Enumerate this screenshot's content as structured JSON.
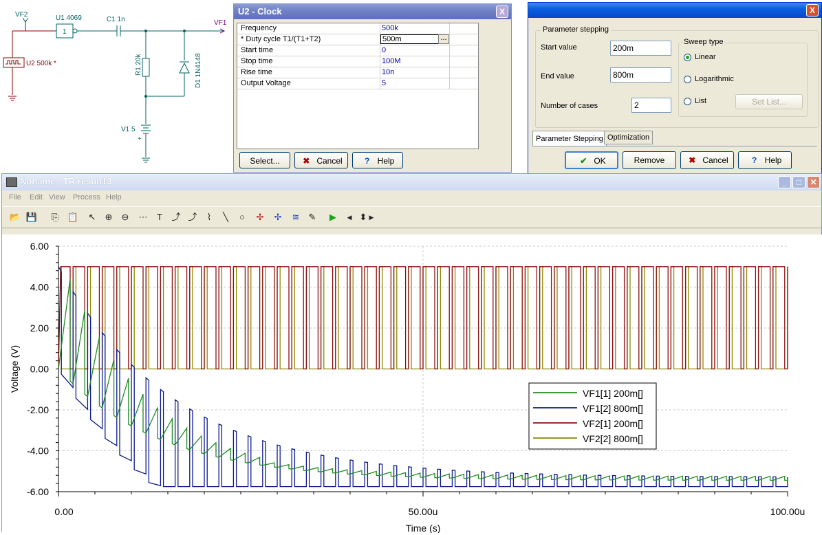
{
  "schematic": {
    "vf2_label": "VF2",
    "vf1_label": "VF1",
    "u1_label": "U1 4069",
    "gate_text": "1",
    "c1_label": "C1 1n",
    "u2_label": "U2 500k *",
    "r1_label": "R1 20k",
    "d1_label": "D1 1N4148",
    "v1_label": "V1 5",
    "plus_sign": "+"
  },
  "clock_dialog": {
    "title": "U2 - Clock",
    "close": "X",
    "rows": [
      {
        "key": "Frequency",
        "value": "500k"
      },
      {
        "key": "* Duty cycle T1/(T1+T2)",
        "value": "500m",
        "editing": true,
        "ellipsis": "..."
      },
      {
        "key": "Start time",
        "value": "0"
      },
      {
        "key": "Stop time",
        "value": "100M"
      },
      {
        "key": "Rise time",
        "value": "10n"
      },
      {
        "key": "Output Voltage",
        "value": "5"
      }
    ],
    "select_btn": "Select...",
    "cancel_btn": "Cancel",
    "help_btn": "Help"
  },
  "param_dialog": {
    "close": "X",
    "group_title": "Parameter stepping",
    "start_label": "Start value",
    "start_value": "200m",
    "end_label": "End value",
    "end_value": "800m",
    "cases_label": "Number of cases",
    "cases_value": "2",
    "sweep_title": "Sweep type",
    "sweep_options": [
      "Linear",
      "Logarithmic",
      "List"
    ],
    "sweep_selected": "Linear",
    "set_list_btn": "Set List...",
    "tabs": [
      "Parameter Stepping",
      "Optimization"
    ],
    "ok_btn": "OK",
    "remove_btn": "Remove",
    "cancel_btn": "Cancel",
    "help_btn": "Help"
  },
  "tr_window": {
    "title": "Noname - TR result13",
    "menu": [
      "File",
      "Edit",
      "View",
      "Process",
      "Help"
    ],
    "toolbar_icons": [
      "open-icon",
      "save-icon",
      "copy-icon",
      "paste-icon",
      "pointer-icon",
      "zoom-in-icon",
      "zoom-out-icon",
      "grid-icon",
      "text-icon",
      "curve-label-icon",
      "curve-label2-icon",
      "axis-label-icon",
      "line-icon",
      "circle-icon",
      "cursor-a-icon",
      "cursor-b-icon",
      "waveform-icon",
      "probe-icon",
      "run-icon",
      "scroll-left-icon",
      "scroll-updown-icon",
      "scroll-right-icon"
    ],
    "colors": {
      "vf1_200m": "#1f8a1f",
      "vf1_800m": "#0a1a8c",
      "vf2_200m": "#8c1010",
      "vf2_800m": "#8c8a00"
    }
  },
  "chart_data": {
    "type": "line",
    "xlabel": "Time (s)",
    "ylabel": "Voltage (V)",
    "xlim": [
      0,
      100
    ],
    "ylim": [
      -6,
      6
    ],
    "x_ticks": [
      "0.00",
      "50.00u",
      "100.00u"
    ],
    "y_ticks": [
      "6.00",
      "4.00",
      "2.00",
      "0.00",
      "-2.00",
      "-4.00",
      "-6.00"
    ],
    "grid": true,
    "legend_placement": "center-right",
    "period_us": 2,
    "series": [
      {
        "name": "VF1[1]  200m[]",
        "color": "#1f8a1f",
        "low_start": 0,
        "low_end": -5.4,
        "spike": 0.3
      },
      {
        "name": "VF1[2]  800m[]",
        "color": "#0a1a8c",
        "low_start": 5.0,
        "low_end": -5.6,
        "spike": 4.2
      },
      {
        "name": "VF2[1]  200m[]",
        "color": "#8c1010",
        "high": 5,
        "low": 0,
        "duty": 0.8
      },
      {
        "name": "VF2[2]  800m[]",
        "color": "#8c8a00",
        "high": 5,
        "low": 0,
        "duty": 0.2
      }
    ]
  }
}
